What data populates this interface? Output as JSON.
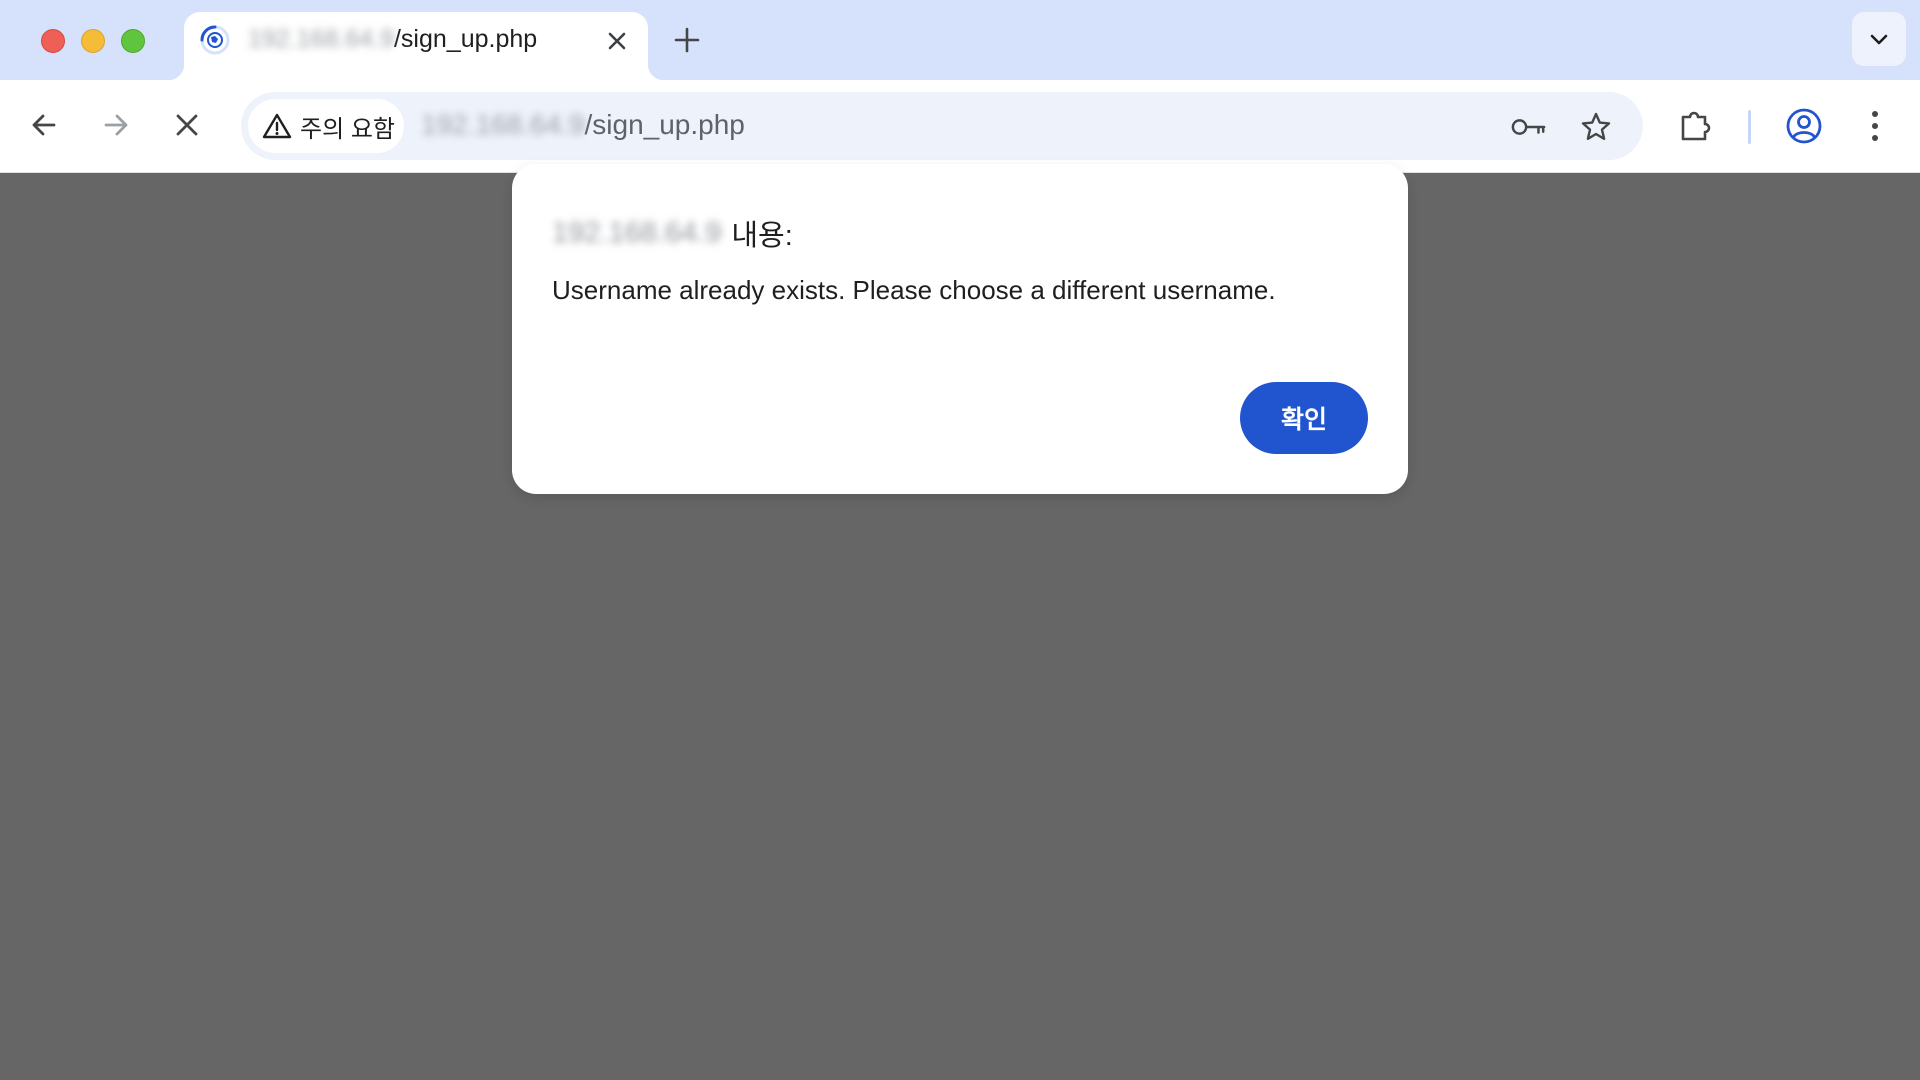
{
  "window": {
    "traffic_lights": [
      "close",
      "minimize",
      "maximize"
    ]
  },
  "tab": {
    "host_blurred": "192.168.64.9",
    "path": "/sign_up.php",
    "favicon": "loading-globe-icon",
    "close_icon": "close-icon"
  },
  "tabstrip": {
    "new_tab_icon": "plus-icon",
    "tab_search_icon": "chevron-down-icon"
  },
  "toolbar": {
    "back_icon": "arrow-left-icon",
    "forward_icon": "arrow-right-icon",
    "stop_icon": "close-icon",
    "security_label": "주의 요함",
    "security_icon": "warning-icon",
    "url_host_blurred": "192.168.64.9",
    "url_path": "/sign_up.php",
    "password_icon": "key-icon",
    "bookmark_icon": "star-icon",
    "extensions_icon": "puzzle-icon",
    "profile_icon": "account-circle-icon",
    "menu_icon": "kebab-menu-icon"
  },
  "dialog": {
    "origin_blurred": "192.168.64.9",
    "title_suffix": "내용:",
    "message": "Username already exists. Please choose a different username.",
    "ok_label": "확인"
  },
  "colors": {
    "tabstrip_bg": "#d6e2fb",
    "page_overlay": "#666666",
    "primary_button": "#2154cf",
    "profile_accent": "#2154cf"
  }
}
